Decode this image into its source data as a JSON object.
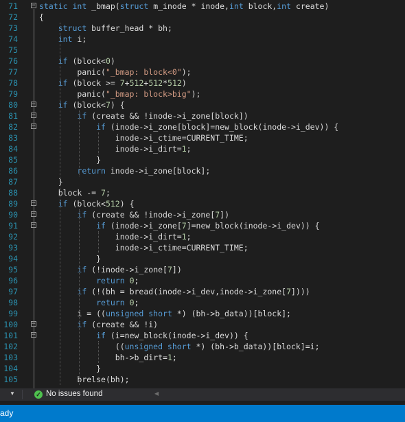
{
  "code_lines": [
    {
      "no": "71",
      "fold": "−",
      "tokens": [
        [
          "kw",
          "static "
        ],
        [
          "kw",
          "int"
        ],
        [
          "id",
          " _bmap"
        ],
        [
          "p",
          "("
        ],
        [
          "kw",
          "struct"
        ],
        [
          "p",
          " m_inode * inode,"
        ],
        [
          "kw",
          "int"
        ],
        [
          "p",
          " block,"
        ],
        [
          "kw",
          "int"
        ],
        [
          "p",
          " create)"
        ]
      ]
    },
    {
      "no": "72",
      "tokens": [
        [
          "p",
          "{"
        ]
      ]
    },
    {
      "no": "73",
      "tokens": [
        [
          "p",
          "    "
        ],
        [
          "kw",
          "struct"
        ],
        [
          "id",
          " buffer_head"
        ],
        [
          "p",
          " * bh;"
        ]
      ]
    },
    {
      "no": "74",
      "tokens": [
        [
          "p",
          "    "
        ],
        [
          "kw",
          "int"
        ],
        [
          "p",
          " i;"
        ]
      ]
    },
    {
      "no": "75",
      "tokens": []
    },
    {
      "no": "76",
      "tokens": [
        [
          "p",
          "    "
        ],
        [
          "kw",
          "if"
        ],
        [
          "p",
          " (block<"
        ],
        [
          "num",
          "0"
        ],
        [
          "p",
          ")"
        ]
      ]
    },
    {
      "no": "77",
      "tokens": [
        [
          "p",
          "        panic("
        ],
        [
          "str",
          "\"_bmap: block<0\""
        ],
        [
          "p",
          ");"
        ]
      ]
    },
    {
      "no": "78",
      "tokens": [
        [
          "p",
          "    "
        ],
        [
          "kw",
          "if"
        ],
        [
          "p",
          " (block >= "
        ],
        [
          "num",
          "7"
        ],
        [
          "p",
          "+"
        ],
        [
          "num",
          "512"
        ],
        [
          "p",
          "+"
        ],
        [
          "num",
          "512"
        ],
        [
          "p",
          "*"
        ],
        [
          "num",
          "512"
        ],
        [
          "p",
          ")"
        ]
      ]
    },
    {
      "no": "79",
      "tokens": [
        [
          "p",
          "        panic("
        ],
        [
          "str",
          "\"_bmap: block>big\""
        ],
        [
          "p",
          ");"
        ]
      ]
    },
    {
      "no": "80",
      "fold": "−",
      "tokens": [
        [
          "p",
          "    "
        ],
        [
          "kw",
          "if"
        ],
        [
          "p",
          " (block<"
        ],
        [
          "num",
          "7"
        ],
        [
          "p",
          ") {"
        ]
      ]
    },
    {
      "no": "81",
      "fold": "−",
      "tokens": [
        [
          "p",
          "        "
        ],
        [
          "kw",
          "if"
        ],
        [
          "p",
          " (create && !inode->"
        ],
        [
          "id",
          "i_zone"
        ],
        [
          "p",
          "[block])"
        ]
      ]
    },
    {
      "no": "82",
      "fold": "−",
      "tokens": [
        [
          "p",
          "            "
        ],
        [
          "kw",
          "if"
        ],
        [
          "p",
          " (inode->"
        ],
        [
          "id",
          "i_zone"
        ],
        [
          "p",
          "[block]="
        ],
        [
          "id",
          "new_block"
        ],
        [
          "p",
          "(inode->"
        ],
        [
          "id",
          "i_dev"
        ],
        [
          "p",
          ")) {"
        ]
      ]
    },
    {
      "no": "83",
      "tokens": [
        [
          "p",
          "                inode->"
        ],
        [
          "id",
          "i_ctime"
        ],
        [
          "p",
          "=CURRENT_TIME;"
        ]
      ]
    },
    {
      "no": "84",
      "tokens": [
        [
          "p",
          "                inode->"
        ],
        [
          "id",
          "i_dirt"
        ],
        [
          "p",
          "="
        ],
        [
          "num",
          "1"
        ],
        [
          "p",
          ";"
        ]
      ]
    },
    {
      "no": "85",
      "tokens": [
        [
          "p",
          "            }"
        ]
      ]
    },
    {
      "no": "86",
      "tokens": [
        [
          "p",
          "        "
        ],
        [
          "kw",
          "return"
        ],
        [
          "p",
          " inode->"
        ],
        [
          "id",
          "i_zone"
        ],
        [
          "p",
          "[block];"
        ]
      ]
    },
    {
      "no": "87",
      "tokens": [
        [
          "p",
          "    }"
        ]
      ]
    },
    {
      "no": "88",
      "tokens": [
        [
          "p",
          "    block -= "
        ],
        [
          "num",
          "7"
        ],
        [
          "p",
          ";"
        ]
      ]
    },
    {
      "no": "89",
      "fold": "−",
      "tokens": [
        [
          "p",
          "    "
        ],
        [
          "kw",
          "if"
        ],
        [
          "p",
          " (block<"
        ],
        [
          "num",
          "512"
        ],
        [
          "p",
          ") {"
        ]
      ]
    },
    {
      "no": "90",
      "fold": "−",
      "tokens": [
        [
          "p",
          "        "
        ],
        [
          "kw",
          "if"
        ],
        [
          "p",
          " (create && !inode->"
        ],
        [
          "id",
          "i_zone"
        ],
        [
          "p",
          "["
        ],
        [
          "num",
          "7"
        ],
        [
          "p",
          "])"
        ]
      ]
    },
    {
      "no": "91",
      "fold": "−",
      "tokens": [
        [
          "p",
          "            "
        ],
        [
          "kw",
          "if"
        ],
        [
          "p",
          " (inode->"
        ],
        [
          "id",
          "i_zone"
        ],
        [
          "p",
          "["
        ],
        [
          "num",
          "7"
        ],
        [
          "p",
          "]="
        ],
        [
          "id",
          "new_block"
        ],
        [
          "p",
          "(inode->"
        ],
        [
          "id",
          "i_dev"
        ],
        [
          "p",
          ")) {"
        ]
      ]
    },
    {
      "no": "92",
      "tokens": [
        [
          "p",
          "                inode->"
        ],
        [
          "id",
          "i_dirt"
        ],
        [
          "p",
          "="
        ],
        [
          "num",
          "1"
        ],
        [
          "p",
          ";"
        ]
      ]
    },
    {
      "no": "93",
      "tokens": [
        [
          "p",
          "                inode->"
        ],
        [
          "id",
          "i_ctime"
        ],
        [
          "p",
          "=CURRENT_TIME;"
        ]
      ]
    },
    {
      "no": "94",
      "tokens": [
        [
          "p",
          "            }"
        ]
      ]
    },
    {
      "no": "95",
      "tokens": [
        [
          "p",
          "        "
        ],
        [
          "kw",
          "if"
        ],
        [
          "p",
          " (!inode->"
        ],
        [
          "id",
          "i_zone"
        ],
        [
          "p",
          "["
        ],
        [
          "num",
          "7"
        ],
        [
          "p",
          "])"
        ]
      ]
    },
    {
      "no": "96",
      "tokens": [
        [
          "p",
          "            "
        ],
        [
          "kw",
          "return"
        ],
        [
          "p",
          " "
        ],
        [
          "num",
          "0"
        ],
        [
          "p",
          ";"
        ]
      ]
    },
    {
      "no": "97",
      "tokens": [
        [
          "p",
          "        "
        ],
        [
          "kw",
          "if"
        ],
        [
          "p",
          " (!(bh = "
        ],
        [
          "id",
          "bread"
        ],
        [
          "p",
          "(inode->"
        ],
        [
          "id",
          "i_dev"
        ],
        [
          "p",
          ",inode->"
        ],
        [
          "id",
          "i_zone"
        ],
        [
          "p",
          "["
        ],
        [
          "num",
          "7"
        ],
        [
          "p",
          "])))"
        ]
      ]
    },
    {
      "no": "98",
      "tokens": [
        [
          "p",
          "            "
        ],
        [
          "kw",
          "return"
        ],
        [
          "p",
          " "
        ],
        [
          "num",
          "0"
        ],
        [
          "p",
          ";"
        ]
      ]
    },
    {
      "no": "99",
      "tokens": [
        [
          "p",
          "        i = (("
        ],
        [
          "kw",
          "unsigned short"
        ],
        [
          "p",
          " *) (bh->"
        ],
        [
          "id",
          "b_data"
        ],
        [
          "p",
          "))[block];"
        ]
      ]
    },
    {
      "no": "100",
      "fold": "−",
      "tokens": [
        [
          "p",
          "        "
        ],
        [
          "kw",
          "if"
        ],
        [
          "p",
          " (create && !i)"
        ]
      ]
    },
    {
      "no": "101",
      "fold": "−",
      "tokens": [
        [
          "p",
          "            "
        ],
        [
          "kw",
          "if"
        ],
        [
          "p",
          " (i="
        ],
        [
          "id",
          "new_block"
        ],
        [
          "p",
          "(inode->"
        ],
        [
          "id",
          "i_dev"
        ],
        [
          "p",
          ")) {"
        ]
      ]
    },
    {
      "no": "102",
      "tokens": [
        [
          "p",
          "                (("
        ],
        [
          "kw",
          "unsigned short"
        ],
        [
          "p",
          " *) (bh->"
        ],
        [
          "id",
          "b_data"
        ],
        [
          "p",
          "))[block]=i;"
        ]
      ]
    },
    {
      "no": "103",
      "tokens": [
        [
          "p",
          "                bh->"
        ],
        [
          "id",
          "b_dirt"
        ],
        [
          "p",
          "="
        ],
        [
          "num",
          "1"
        ],
        [
          "p",
          ";"
        ]
      ]
    },
    {
      "no": "104",
      "tokens": [
        [
          "p",
          "            }"
        ]
      ]
    },
    {
      "no": "105",
      "tokens": [
        [
          "p",
          "        "
        ],
        [
          "id",
          "brelse"
        ],
        [
          "p",
          "(bh);"
        ]
      ]
    }
  ],
  "colors": {
    "background": "#1e1e1e",
    "line_number": "#2b91af",
    "keyword": "#569cd6",
    "string": "#d69d85",
    "number": "#b5cea8",
    "text": "#dcdcdc",
    "status_bar": "#007acc",
    "ok": "#4ec14e"
  },
  "status": {
    "issues_icon": "check-circle-icon",
    "issues_text": "No issues found"
  },
  "bottom_bar": {
    "text": "ady"
  }
}
